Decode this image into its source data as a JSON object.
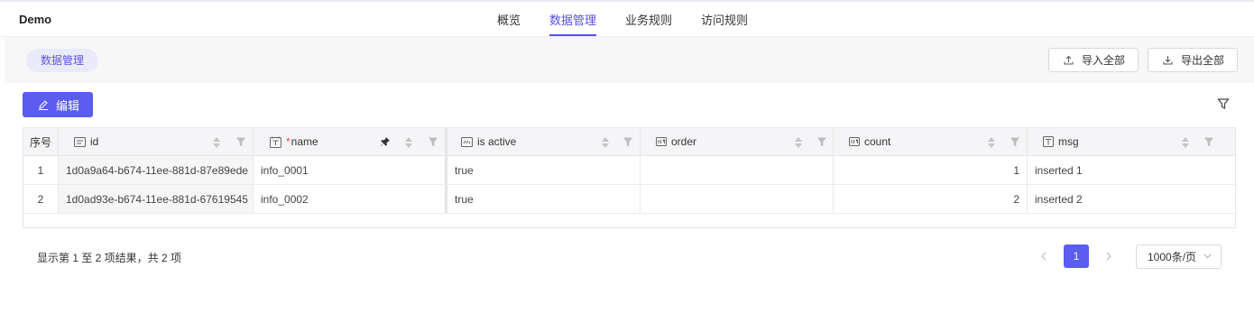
{
  "app": {
    "title": "Demo"
  },
  "nav": {
    "tabs": [
      {
        "label": "概览"
      },
      {
        "label": "数据管理"
      },
      {
        "label": "业务规则"
      },
      {
        "label": "访问规则"
      }
    ],
    "active_index": 1
  },
  "subbar": {
    "pill_label": "数据管理",
    "import_label": "导入全部",
    "export_label": "导出全部"
  },
  "toolbar": {
    "edit_label": "编辑"
  },
  "table": {
    "columns": {
      "index": "序号",
      "id": "id",
      "name_required": "*",
      "name": "name",
      "is_active": "is active",
      "order": "order",
      "count": "count",
      "msg": "msg"
    },
    "rows": [
      {
        "index": "1",
        "id": "1d0a9a64-b674-11ee-881d-87e89ede",
        "name": "info_0001",
        "is_active": "true",
        "order": "",
        "count": "1",
        "msg": "inserted 1"
      },
      {
        "index": "2",
        "id": "1d0ad93e-b674-11ee-881d-67619545",
        "name": "info_0002",
        "is_active": "true",
        "order": "",
        "count": "2",
        "msg": "inserted 2"
      }
    ]
  },
  "footer": {
    "summary": "显示第 1 至 2 项结果，共 2 项",
    "current_page": "1",
    "page_size": "1000条/页"
  },
  "colors": {
    "accent": "#5b5cf0",
    "pill_bg": "#ebeafb",
    "header_bg": "#f5f5f7"
  }
}
